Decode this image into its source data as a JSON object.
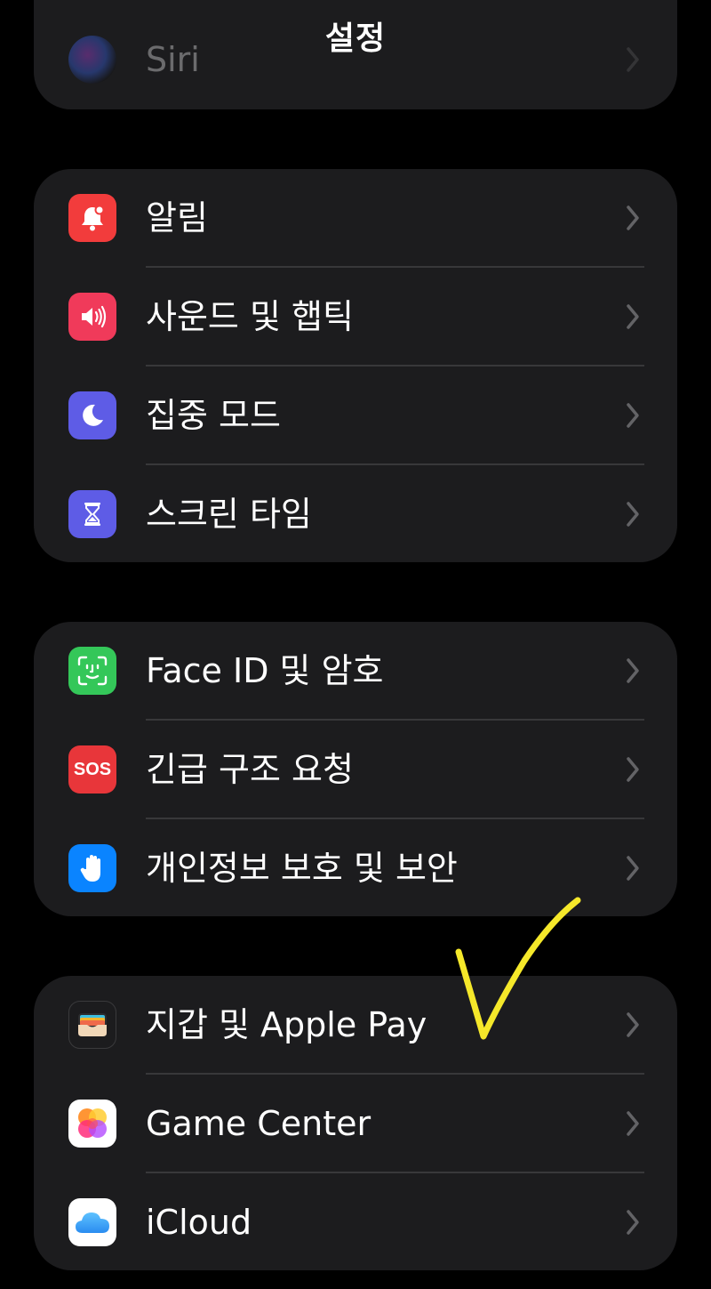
{
  "header": {
    "title": "설정"
  },
  "partial_row": {
    "label": "Siri",
    "icon": "siri-icon"
  },
  "groups": [
    {
      "items": [
        {
          "label": "알림",
          "icon": "bell-icon",
          "color": "#f23c3c"
        },
        {
          "label": "사운드 및 햅틱",
          "icon": "speaker-icon",
          "color": "#f03a5a"
        },
        {
          "label": "집중 모드",
          "icon": "moon-icon",
          "color": "#5e5ce6"
        },
        {
          "label": "스크린 타임",
          "icon": "hourglass-icon",
          "color": "#5e5ce6"
        }
      ]
    },
    {
      "items": [
        {
          "label": "Face ID 및 암호",
          "icon": "face-id-icon",
          "color": "#34c759"
        },
        {
          "label": "긴급 구조 요청",
          "icon": "sos-icon",
          "icon_text": "SOS",
          "color": "#e8363a"
        },
        {
          "label": "개인정보 보호 및 보안",
          "icon": "hand-icon",
          "color": "#0a84ff"
        }
      ]
    },
    {
      "items": [
        {
          "label": "지갑 및 Apple Pay",
          "icon": "wallet-icon",
          "color": "#1c1c1e"
        },
        {
          "label": "Game Center",
          "icon": "game-center-icon",
          "color": "#ffffff"
        },
        {
          "label": "iCloud",
          "icon": "icloud-icon",
          "color": "#ffffff"
        }
      ]
    }
  ],
  "annotation": {
    "mark": "checkmark",
    "color": "#f5e82a"
  }
}
